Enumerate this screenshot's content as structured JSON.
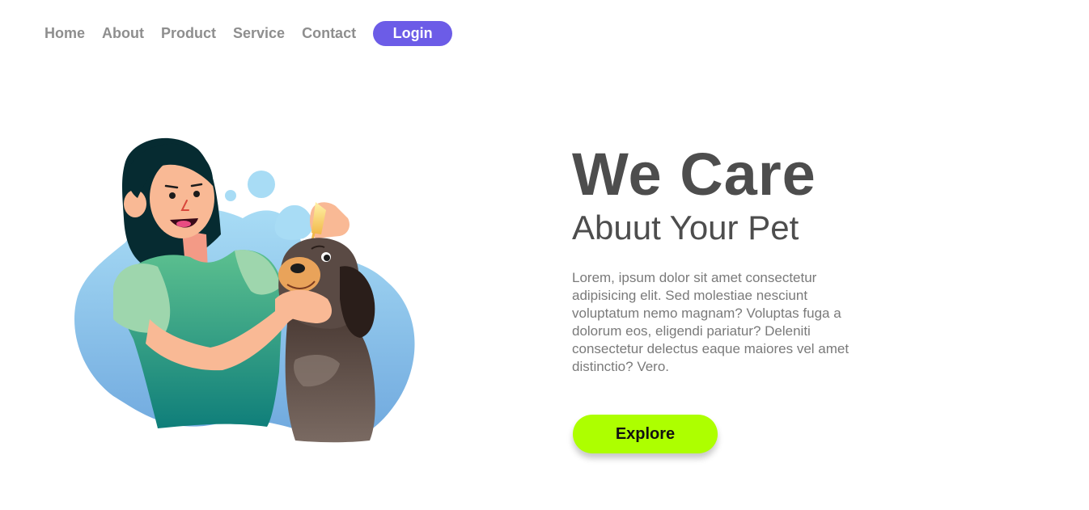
{
  "nav": {
    "links": [
      "Home",
      "About",
      "Product",
      "Service",
      "Contact"
    ],
    "login_label": "Login"
  },
  "hero": {
    "title": "We Care",
    "subtitle": "Abuut Your Pet",
    "description": "Lorem, ipsum dolor sit amet consectetur adipisicing elit. Sed molestiae nesciunt voluptatum nemo magnam? Voluptas fuga a dolorum eos, eligendi pariatur? Deleniti consectetur delectus eaque maiores vel amet distinctio? Vero.",
    "explore_label": "Explore"
  },
  "colors": {
    "accent": "#6c5ce7",
    "cta": "#adff00",
    "heading": "#4d4d4d",
    "nav_text": "#8e8e8e",
    "body_text": "#7a7a7a"
  },
  "icons": {
    "illustration": "woman-with-dog-illustration"
  }
}
